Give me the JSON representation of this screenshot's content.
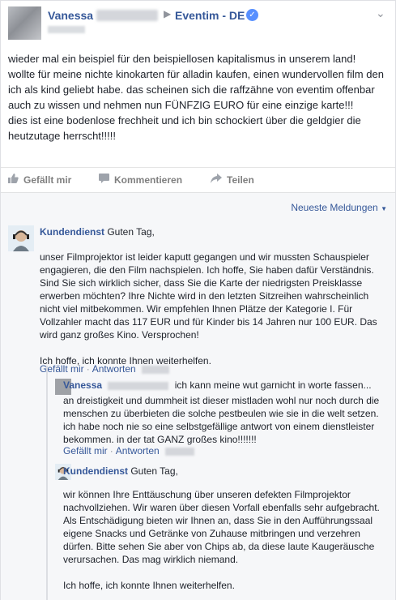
{
  "post": {
    "author": "Vanessa",
    "page": "Eventim - DE",
    "separator": "▶",
    "text": "wieder mal ein beispiel für den beispiellosen kapitalismus in unserem land!\nwollte für meine nichte kinokarten für alladin kaufen, einen wundervollen film den ich als kind geliebt habe. das scheinen sich die raffzähne von eventim offenbar auch zu wissen und nehmen nun FÜNFZIG EURO für eine einzige karte!!!\ndies ist eine bodenlose frechheit und ich bin schockiert über die geldgier die heutzutage herrscht!!!!!"
  },
  "actions": {
    "like": "Gefällt mir",
    "comment": "Kommentieren",
    "share": "Teilen"
  },
  "comments_sort": "Neueste Meldungen",
  "comments": [
    {
      "author": "Kundendienst",
      "greeting": "Guten Tag,",
      "body": "unser Filmprojektor ist leider kaputt gegangen und wir mussten Schauspieler engagieren, die den Film nachspielen. Ich hoffe, Sie haben dafür Verständnis. Sind Sie sich wirklich sicher, dass Sie die Karte der niedrigsten Preisklasse erwerben möchten? Ihre Nichte wird in den letzten Sitzreihen wahrscheinlich nicht viel mitbekommen. Wir empfehlen Ihnen Plätze der Kategorie I. Für Vollzahler macht das 117 EUR und für Kinder bis 14 Jahren nur 100 EUR. Das wird ganz großes Kino. Versprochen!\n\nIch hoffe, ich konnte Ihnen weiterhelfen.",
      "like": "Gefällt mir",
      "dot": "·",
      "reply": "Antworten"
    },
    {
      "author": "Vanessa",
      "first_line": "ich kann meine wut garnicht in worte fassen...",
      "body": "an dreistigkeit und dummheit ist dieser mistladen wohl nur noch durch die menschen zu überbieten die solche pestbeulen wie sie in die welt setzen. ich habe noch nie so eine selbstgefällige antwort von einem dienstleister bekommen. in der tat GANZ großes kino!!!!!!!",
      "like": "Gefällt mir",
      "dot": "·",
      "reply": "Antworten"
    },
    {
      "author": "Kundendienst",
      "greeting": "Guten Tag,",
      "body": "wir können Ihre Enttäuschung über unseren defekten Filmprojektor nachvollziehen. Wir waren über diesen Vorfall ebenfalls sehr aufgebracht. Als Entschädigung bieten wir Ihnen an, dass Sie in den Aufführungssaal eigene Snacks und Getränke von Zuhause mitbringen und verzehren dürfen. Bitte sehen Sie aber von Chips ab, da diese laute Kaugeräusche verursachen. Das mag wirklich niemand.\n\nIch hoffe, ich konnte Ihnen weiterhelfen."
    }
  ],
  "colors": {
    "link": "#365899",
    "text": "#1d2129",
    "muted": "#7f7f7f",
    "comments_bg": "#f6f7f9",
    "verified": "#5890ff"
  },
  "icons": {
    "like": "thumbs-up-icon",
    "comment": "speech-bubble-icon",
    "share": "share-arrow-icon",
    "verified": "verified-check-icon",
    "menu": "chevron-down-icon"
  }
}
